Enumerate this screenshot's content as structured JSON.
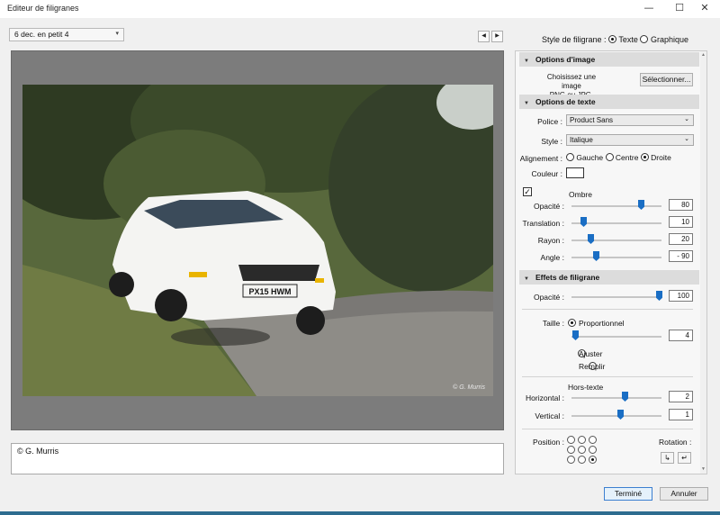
{
  "window": {
    "title": "Editeur de filigranes"
  },
  "preset": {
    "selected": "6 dec. en petit 4"
  },
  "watermark_style": {
    "label": "Style de filigrane :",
    "options": [
      "Texte",
      "Graphique"
    ],
    "selected": "Texte"
  },
  "preview": {
    "overlay_text": "© G. Murris",
    "plate": "PX15 HWM"
  },
  "text_input": {
    "value": "© G. Murris"
  },
  "image_options": {
    "header": "Options d'image",
    "hint_line1": "Choisissez une image",
    "hint_line2": "PNG ou JPG.",
    "select_button": "Sélectionner..."
  },
  "text_options": {
    "header": "Options de texte",
    "font_label": "Police :",
    "font_value": "Product Sans",
    "style_label": "Style :",
    "style_value": "Italique",
    "align_label": "Alignement :",
    "align_options": [
      "Gauche",
      "Centre",
      "Droite"
    ],
    "align_selected": "Droite",
    "color_label": "Couleur :",
    "color_value": "#ffffff",
    "shadow_label": "Ombre",
    "shadow_checked": true,
    "opacity_label": "Opacité :",
    "opacity_value": "80",
    "translation_label": "Translation :",
    "translation_value": "10",
    "radius_label": "Rayon :",
    "radius_value": "20",
    "angle_label": "Angle :",
    "angle_value": "- 90"
  },
  "effects": {
    "header": "Effets de filigrane",
    "opacity_label": "Opacité :",
    "opacity_value": "100",
    "size_label": "Taille :",
    "size_options": [
      "Proportionnel",
      "Ajuster",
      "Remplir"
    ],
    "size_selected": "Proportionnel",
    "size_value": "4",
    "inset_label": "Hors-texte",
    "horizontal_label": "Horizontal :",
    "horizontal_value": "2",
    "vertical_label": "Vertical :",
    "vertical_value": "1",
    "position_label": "Position :",
    "position_selected": "bottom-right",
    "rotation_label": "Rotation :"
  },
  "footer": {
    "done_button": "Terminé",
    "cancel_button": "Annuler"
  }
}
